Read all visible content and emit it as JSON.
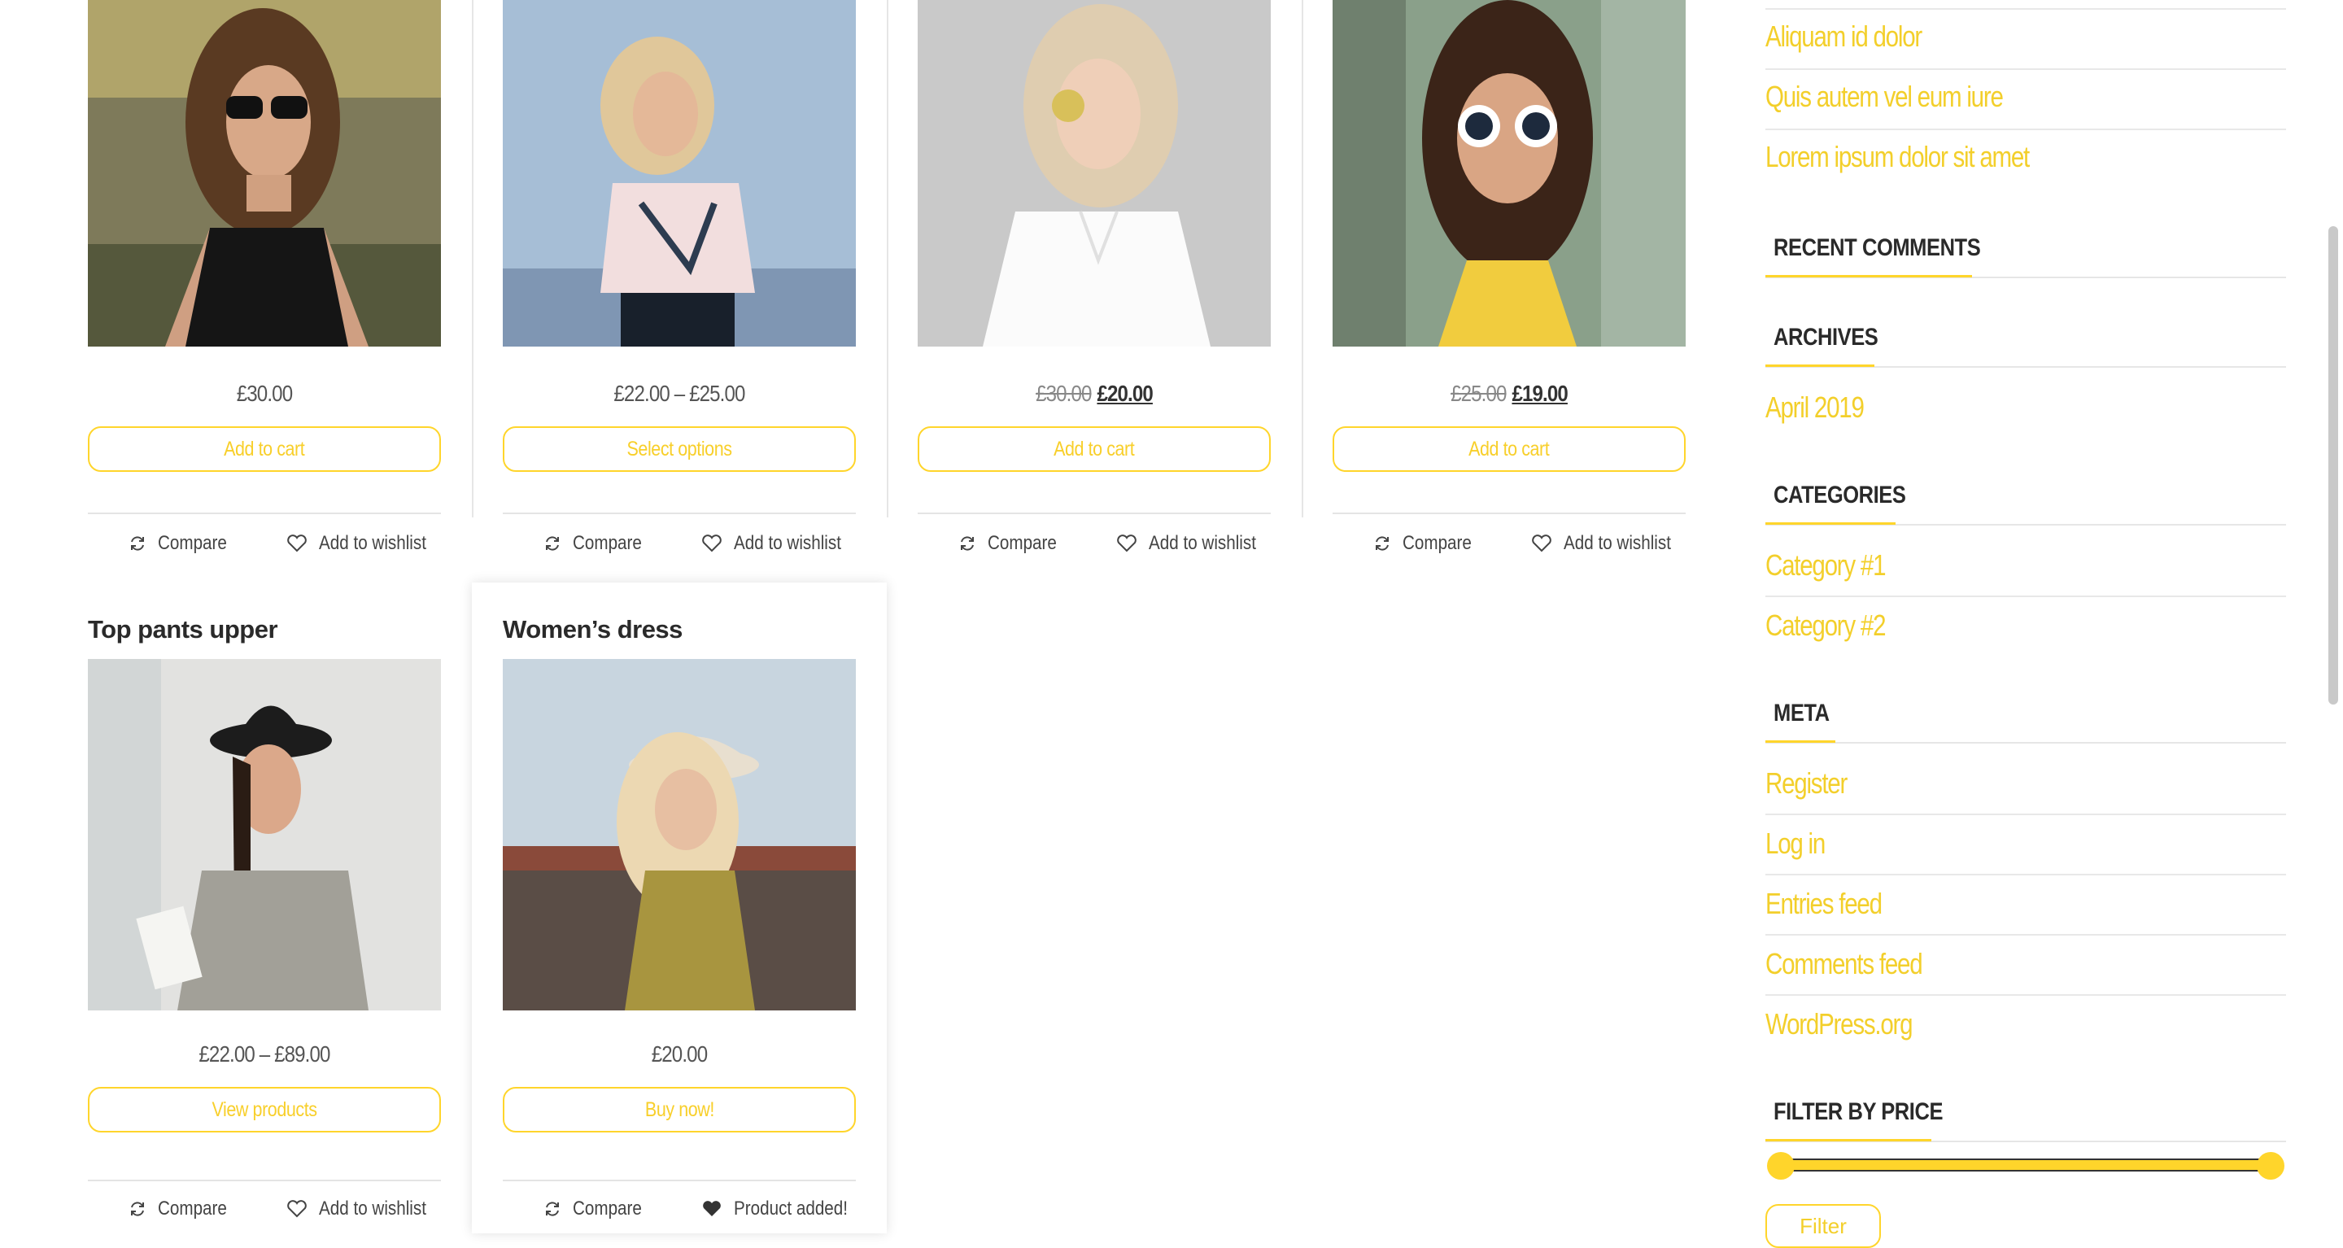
{
  "products_row1": [
    {
      "price_html": "£30.00",
      "button": "Add to cart"
    },
    {
      "price_html": "£22.00 – £25.00",
      "button": "Select options"
    },
    {
      "old_price": "£30.00",
      "new_price": "£20.00",
      "button": "Add to cart"
    },
    {
      "old_price": "£25.00",
      "new_price": "£19.00",
      "button": "Add to cart"
    }
  ],
  "products_row2": [
    {
      "title": "Top pants upper",
      "price_html": "£22.00 – £89.00",
      "button": "View products",
      "wishlist": "Add to wishlist"
    },
    {
      "title": "Women’s dress",
      "price_html": "£20.00",
      "button": "Buy now!",
      "wishlist": "Product added!"
    }
  ],
  "actions": {
    "compare": "Compare",
    "wishlist": "Add to wishlist"
  },
  "sidebar": {
    "recent_posts": [
      "Aliquam id dolor",
      "Quis autem vel eum iure",
      "Lorem ipsum dolor sit amet"
    ],
    "recent_comments_title": "RECENT COMMENTS",
    "archives_title": "ARCHIVES",
    "archives": [
      "April 2019"
    ],
    "categories_title": "CATEGORIES",
    "categories": [
      "Category #1",
      "Category #2"
    ],
    "meta_title": "META",
    "meta": [
      "Register",
      "Log in",
      "Entries feed",
      "Comments feed",
      "WordPress.org"
    ],
    "filter_title": "FILTER BY PRICE",
    "filter_button": "Filter"
  },
  "colors": {
    "accent": "#ffd52b",
    "link": "#f3cf2b"
  }
}
